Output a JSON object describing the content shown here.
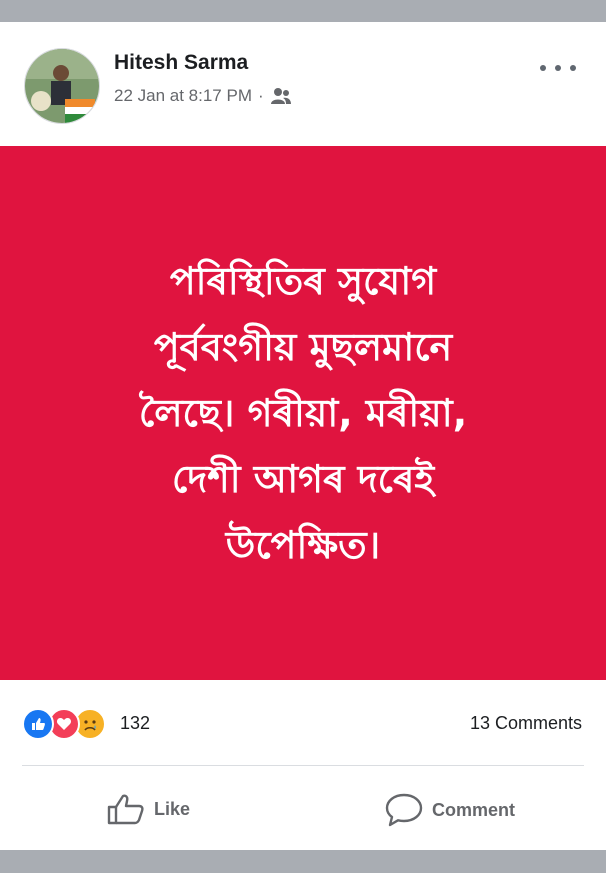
{
  "post": {
    "author": "Hitesh Sarma",
    "timestamp": "22 Jan at 8:17 PM",
    "separator": "·",
    "audience_icon": "friends-icon",
    "background_color": "#e0143f",
    "text_lines": [
      "পৰিস্থিতিৰ সুযোগ",
      "পূৰ্ববংগীয় মুছলমানে",
      "লৈছে। গৰীয়া, মৰীয়া,",
      "দেশী আগৰ দৰেই",
      "উপেক্ষিত।"
    ]
  },
  "reactions": {
    "icons": [
      "like-reaction-icon",
      "love-reaction-icon",
      "sad-reaction-icon"
    ],
    "count": "132",
    "comments": "13 Comments"
  },
  "actions": {
    "like_label": "Like",
    "comment_label": "Comment"
  },
  "colors": {
    "like_blue": "#1877f2",
    "love_red": "#f33e58",
    "sad_yellow": "#f7b125",
    "meta_gray": "#65676b"
  }
}
